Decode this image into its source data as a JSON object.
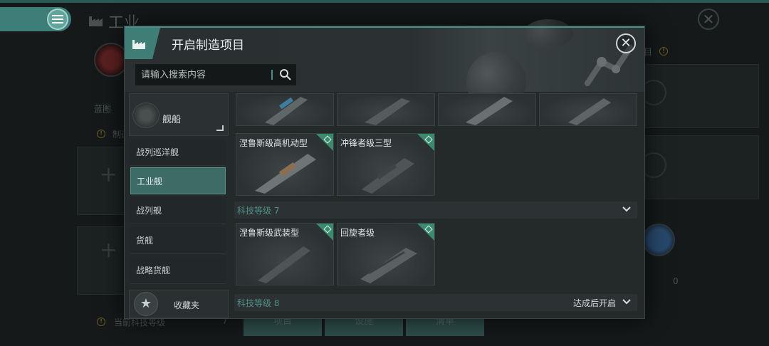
{
  "background": {
    "title": "工业",
    "label_blueprint": "蓝图",
    "label_manufacture": "制造",
    "label_current_tech": "当前科技等级",
    "current_tech_value": "7",
    "counter_value": "0",
    "tabs": [
      "项目",
      "设施",
      "清单"
    ]
  },
  "modal": {
    "title": "开启制造项目",
    "close_symbol": "✕",
    "search": {
      "placeholder": "请输入搜索内容",
      "value": ""
    },
    "category": {
      "main_label": "舰船",
      "items": [
        {
          "label": "战列巡洋舰",
          "active": false
        },
        {
          "label": "工业舰",
          "active": true
        },
        {
          "label": "战列舰",
          "active": false
        },
        {
          "label": "货舰",
          "active": false
        },
        {
          "label": "战略货舰",
          "active": false
        }
      ]
    },
    "favorites_label": "收藏夹",
    "favorites_icon": "★",
    "grid": {
      "cards_row2": [
        {
          "name": "涅鲁斯级高机动型"
        },
        {
          "name": "冲锋者级三型"
        }
      ],
      "tech7_label": "科技等级 7",
      "cards_row3": [
        {
          "name": "涅鲁斯级武装型"
        },
        {
          "name": "回旋者级"
        }
      ],
      "tech8_label": "科技等级 8",
      "tech8_status": "达成后开启"
    }
  },
  "colors": {
    "accent": "#3e7e76",
    "badge": "#3a8a6e",
    "level_text": "#4e8e86"
  }
}
